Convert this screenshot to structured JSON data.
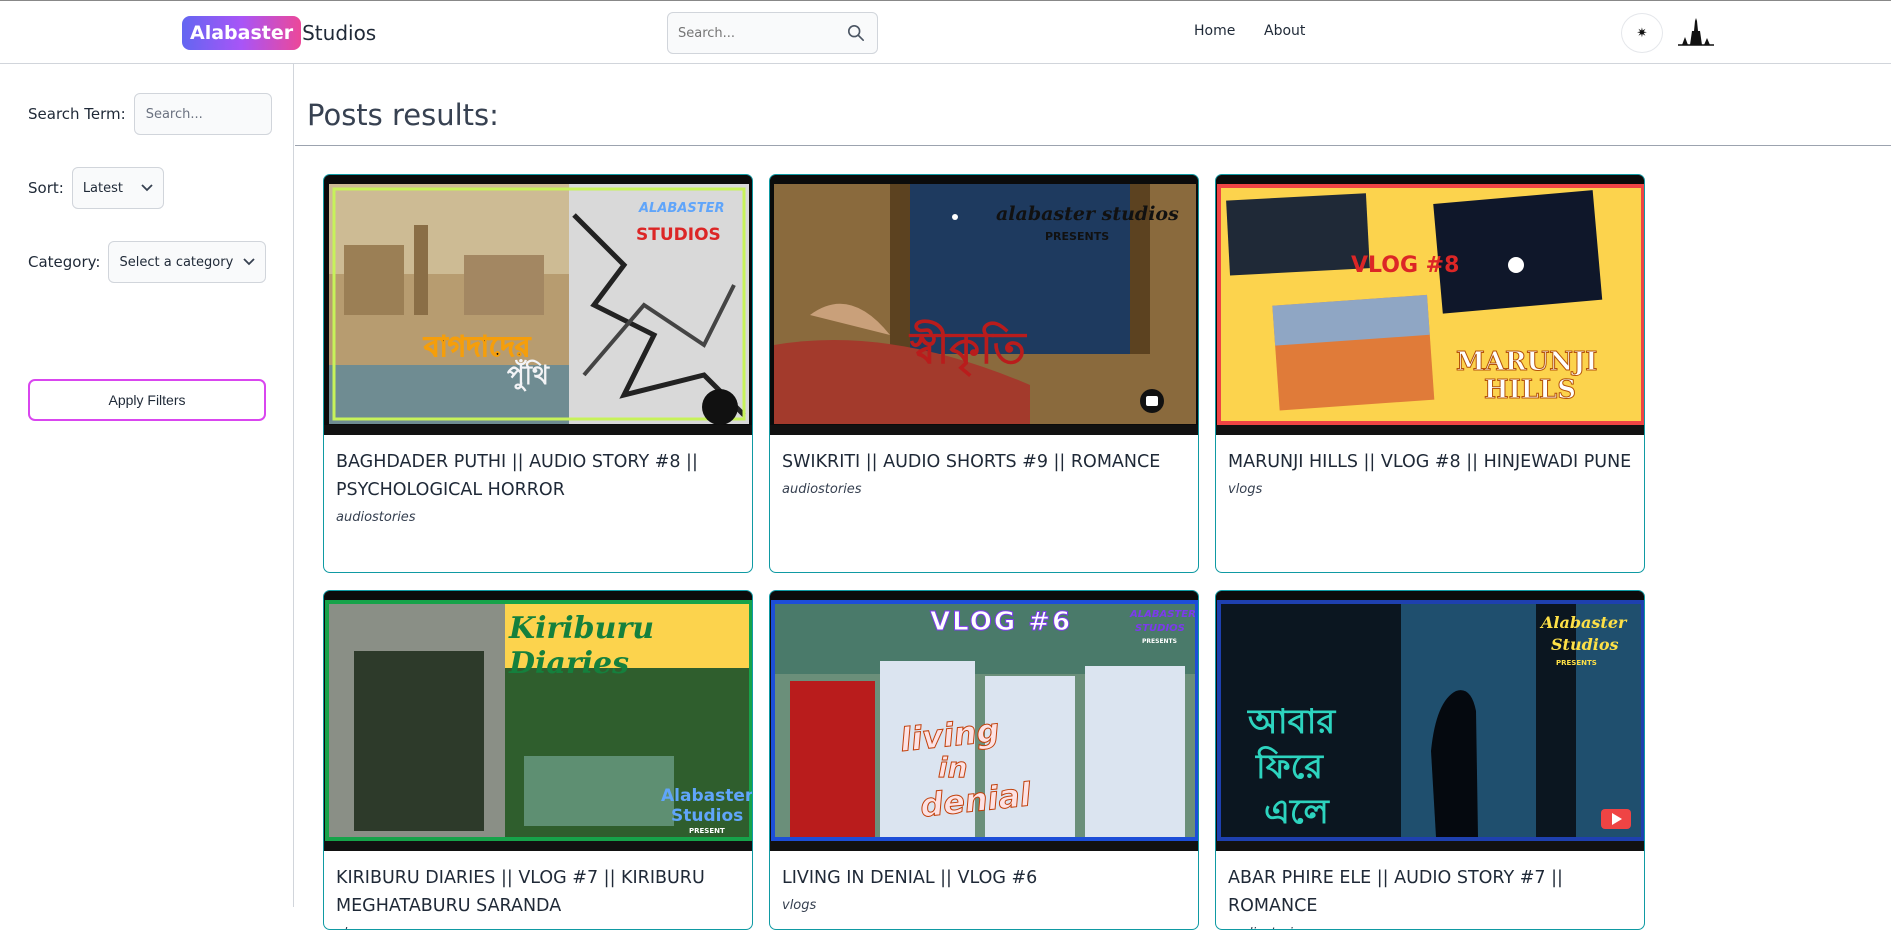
{
  "header": {
    "logo_badge": "Alabaster",
    "logo_rest": "Studios",
    "search_placeholder": "Search...",
    "nav": [
      "Home",
      "About"
    ],
    "theme_icon_glyph": "✷"
  },
  "sidebar": {
    "search_label": "Search Term:",
    "search_placeholder": "Search...",
    "sort_label": "Sort:",
    "sort_value": "Latest",
    "category_label": "Category:",
    "category_value": "Select a category",
    "apply_label": "Apply Filters"
  },
  "main": {
    "title": "Posts results:",
    "posts": [
      {
        "title": "BAGHDADER PUTHI || AUDIO STORY #8 || PSYCHOLOGICAL HORROR",
        "category": "audiostories",
        "thumb_text": [
          "বাগদাদের",
          "পুঁথি",
          "ALABASTER",
          "STUDIOS"
        ]
      },
      {
        "title": "SWIKRITI || AUDIO SHORTS #9 || ROMANCE",
        "category": "audiostories",
        "thumb_text": [
          "স্বীকৃতি",
          "alabaster studios",
          "PRESENTS"
        ]
      },
      {
        "title": "MARUNJI HILLS || VLOG #8 || HINJEWADI PUNE",
        "category": "vlogs",
        "thumb_text": [
          "VLOG #8",
          "MARUNJI",
          "HILLS"
        ]
      },
      {
        "title": "KIRIBURU DIARIES || VLOG #7 || KIRIBURU MEGHATABURU SARANDA",
        "category": "vlogs",
        "thumb_text": [
          "Kiriburu Diaries",
          "Alabaster",
          "Studios",
          "PRESENT"
        ]
      },
      {
        "title": "LIVING IN DENIAL || VLOG #6",
        "category": "vlogs",
        "thumb_text": [
          "VLOG #6",
          "living",
          "in",
          "denial",
          "ALABASTER",
          "STUDIOS",
          "PRESENTS"
        ]
      },
      {
        "title": "ABAR PHIRE ELE || AUDIO STORY #7 || ROMANCE",
        "category": "audiostories",
        "thumb_text": [
          "আবার",
          "ফিরে",
          "এলে",
          "Alabaster",
          "Studios",
          "PRESENTS"
        ]
      }
    ]
  },
  "colors": {
    "accent_teal": "#0f9aa3",
    "apply_border": "#d946ef",
    "logo_gradient": [
      "#6366f1",
      "#a855f7",
      "#ec4899"
    ]
  }
}
